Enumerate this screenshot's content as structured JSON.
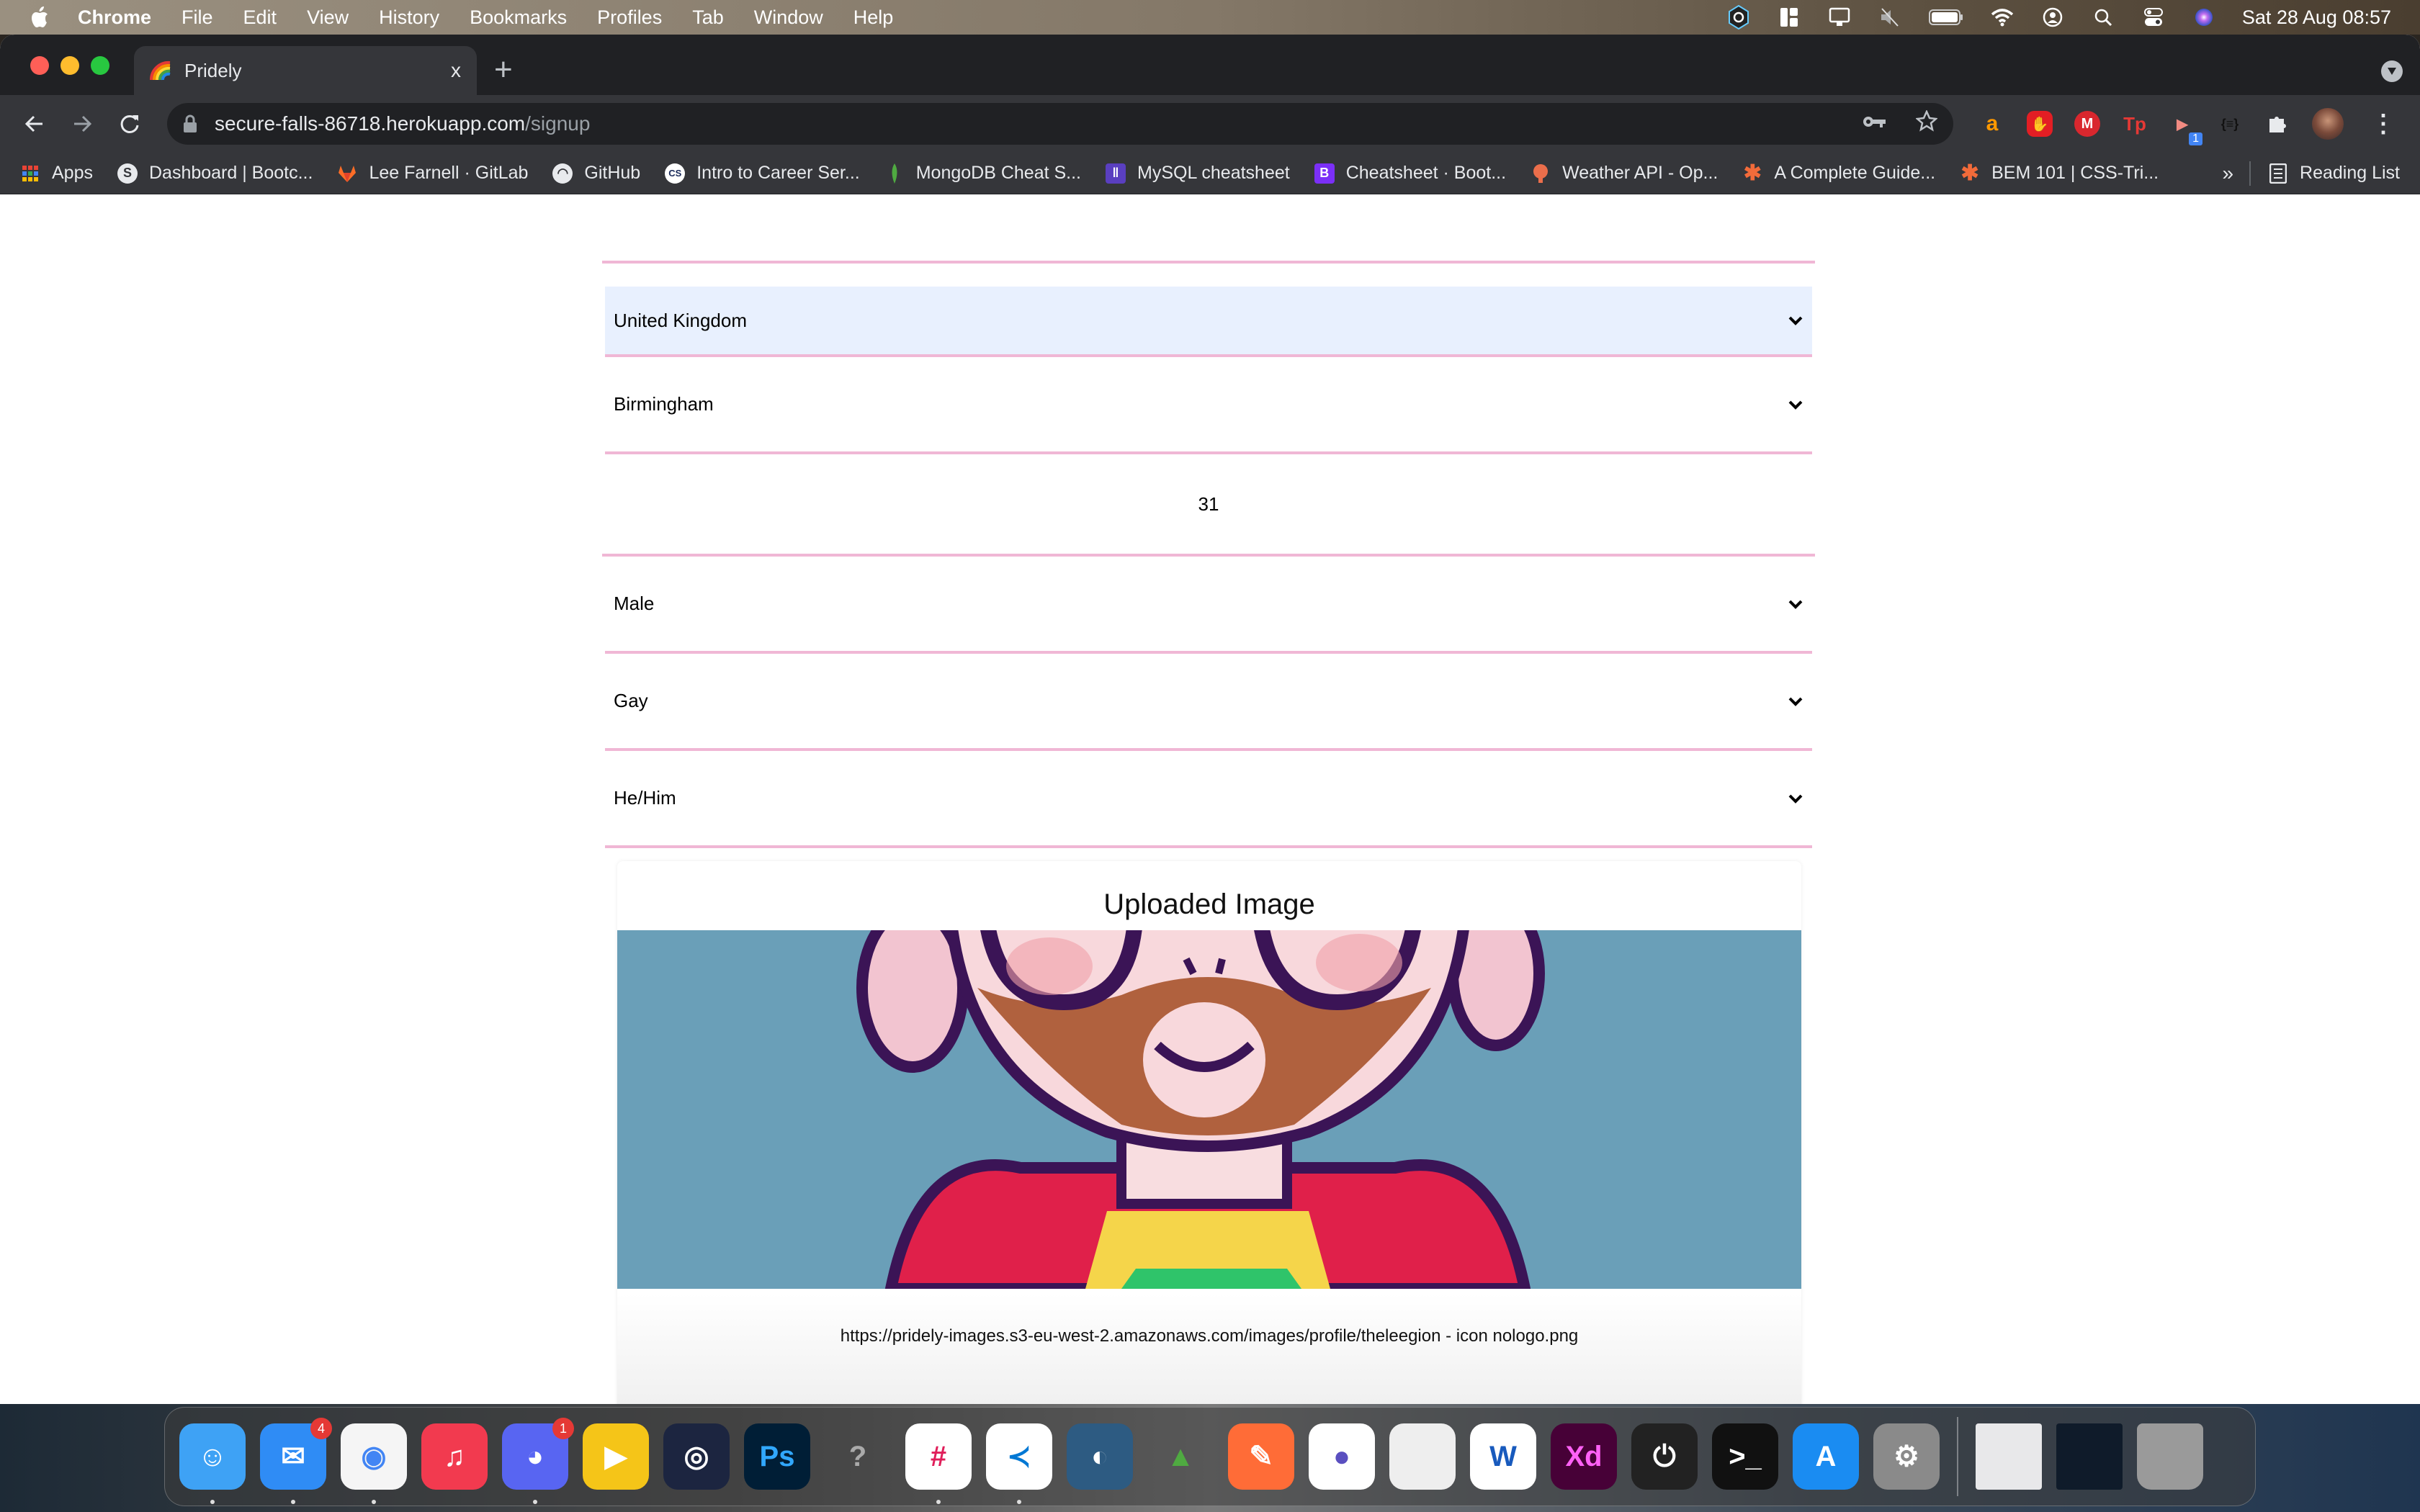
{
  "menubar": {
    "app_name": "Chrome",
    "items": [
      "File",
      "Edit",
      "View",
      "History",
      "Bookmarks",
      "Profiles",
      "Tab",
      "Window",
      "Help"
    ],
    "status_icons": [
      "corsair-icue-icon",
      "layout-icon",
      "display-icon",
      "mute-icon",
      "battery-icon",
      "wifi-icon",
      "user-icon",
      "spotlight-search-icon",
      "control-center-icon",
      "siri-icon"
    ],
    "clock": "Sat 28 Aug  08:57"
  },
  "browser": {
    "tab": {
      "title": "Pridely",
      "favicon": "rainbow-icon",
      "close_label": "x"
    },
    "new_tab_label": "+",
    "url": {
      "host": "secure-falls-86718.herokuapp.com",
      "path": "/signup"
    },
    "extensions": [
      {
        "name": "amazon-extension-icon",
        "label": "a",
        "color": "#232f3e"
      },
      {
        "name": "adblock-extension-icon",
        "label": "✋",
        "color": "#e31e24"
      },
      {
        "name": "mega-extension-icon",
        "label": "M",
        "color": "#d9272e"
      },
      {
        "name": "tp-extension-icon",
        "label": "Tp",
        "color": "#35363a"
      },
      {
        "name": "screen-recorder-extension-icon",
        "label": "▶",
        "color": "#35363a",
        "badge": "1"
      },
      {
        "name": "json-formatter-extension-icon",
        "label": "{≡}",
        "color": "#35363a"
      }
    ],
    "bookmarks": [
      {
        "label": "Apps",
        "icon": "apps-grid-icon"
      },
      {
        "label": "Dashboard | Bootc...",
        "icon": "globe-icon"
      },
      {
        "label": "Lee Farnell · GitLab",
        "icon": "gitlab-icon"
      },
      {
        "label": "GitHub",
        "icon": "github-icon"
      },
      {
        "label": "Intro to Career Ser...",
        "icon": "cs-icon"
      },
      {
        "label": "MongoDB Cheat S...",
        "icon": "mongodb-leaf-icon"
      },
      {
        "label": "MySQL cheatsheet",
        "icon": "clip-icon"
      },
      {
        "label": "Cheatsheet · Boot...",
        "icon": "bootstrap-icon"
      },
      {
        "label": "Weather API - Op...",
        "icon": "weather-icon"
      },
      {
        "label": "A Complete Guide...",
        "icon": "css-tricks-icon"
      },
      {
        "label": "BEM 101 | CSS-Tri...",
        "icon": "css-tricks-icon"
      }
    ],
    "more_bookmarks_label": "»",
    "reading_list_label": "Reading List"
  },
  "form": {
    "country": "United Kingdom",
    "city": "Birmingham",
    "age": "31",
    "gender": "Male",
    "sexuality": "Gay",
    "pronouns": "He/Him"
  },
  "upload_card": {
    "title": "Uploaded Image",
    "image_alt": "cartoon avatar of bearded man with glasses and rainbow shirt",
    "image_url_text": "https://pridely-images.s3-eu-west-2.amazonaws.com/images/profile/theleegion - icon nologo.png"
  },
  "dock": {
    "apps": [
      {
        "name": "finder",
        "bg": "#3ea2f5",
        "glyph": "☺",
        "running": true
      },
      {
        "name": "mail",
        "bg": "#2f8cf5",
        "glyph": "✉",
        "badge": "4",
        "running": true
      },
      {
        "name": "chrome",
        "bg": "#f5f5f5",
        "glyph": "◉",
        "running": true
      },
      {
        "name": "music",
        "bg": "#f23a4f",
        "glyph": "♫",
        "running": false
      },
      {
        "name": "discord",
        "bg": "#5865f2",
        "glyph": "◕",
        "badge": "1",
        "running": true
      },
      {
        "name": "pokemon-tcg-online",
        "bg": "#f5c518",
        "glyph": "▶",
        "running": false
      },
      {
        "name": "obs",
        "bg": "#1c2540",
        "glyph": "◎",
        "running": false
      },
      {
        "name": "photoshop",
        "bg": "#001e36",
        "glyph": "Ps",
        "running": false
      },
      {
        "name": "unknown-app",
        "bg": "transparent",
        "glyph": "?",
        "running": false
      },
      {
        "name": "slack",
        "bg": "#ffffff",
        "glyph": "#",
        "running": true
      },
      {
        "name": "vscode",
        "bg": "#ffffff",
        "glyph": "≺",
        "running": true
      },
      {
        "name": "mysql-workbench",
        "bg": "#2d5b82",
        "glyph": "◐",
        "running": false
      },
      {
        "name": "git-app",
        "bg": "transparent",
        "glyph": "▲",
        "running": false
      },
      {
        "name": "postman",
        "bg": "#ff6c37",
        "glyph": "✎",
        "running": false
      },
      {
        "name": "tor-app",
        "bg": "#ffffff",
        "glyph": "●",
        "running": false
      },
      {
        "name": "libreoffice",
        "bg": "#eeeeee",
        "glyph": "",
        "running": false
      },
      {
        "name": "word",
        "bg": "#ffffff",
        "glyph": "W",
        "running": false
      },
      {
        "name": "adobe-xd",
        "bg": "#470137",
        "glyph": "Xd",
        "running": false
      },
      {
        "name": "corsair-icue",
        "bg": "#222222",
        "glyph": "⏻",
        "running": false
      },
      {
        "name": "terminal",
        "bg": "#111111",
        "glyph": ">_",
        "running": false
      },
      {
        "name": "app-store",
        "bg": "#1a8cf2",
        "glyph": "A",
        "running": false
      },
      {
        "name": "system-preferences",
        "bg": "#8a8a8a",
        "glyph": "⚙",
        "running": false
      }
    ],
    "stacks": [
      {
        "name": "downloads-stack",
        "bg": "#e8e8ea"
      },
      {
        "name": "recent-docs-stack",
        "bg": "#0f1b2a"
      },
      {
        "name": "trash",
        "bg": "#9a9a9a"
      }
    ]
  },
  "colors": {
    "field_underline": "#f0b7d5",
    "autofill_bg": "#e8f0fe",
    "button_border": "#8f9acb",
    "image_bg": "#6a9fb8"
  }
}
